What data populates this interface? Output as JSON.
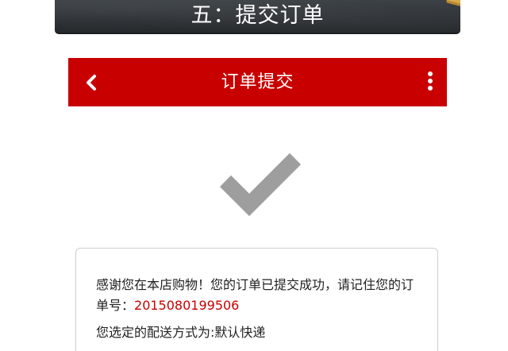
{
  "banner": {
    "title": "五：提交订单"
  },
  "header": {
    "title": "订单提交",
    "back_icon": "chevron-left-icon",
    "menu_icon": "more-vertical-icon",
    "background": "#c90000"
  },
  "status": {
    "icon": "checkmark-icon",
    "icon_color": "#9e9e9e"
  },
  "message": {
    "text": "感谢您在本店购物！您的订单已提交成功，请记住您的订单号：",
    "order_number": "2015080199506",
    "delivery_label": "您选定的配送方式为:",
    "delivery_method": "默认快递"
  }
}
